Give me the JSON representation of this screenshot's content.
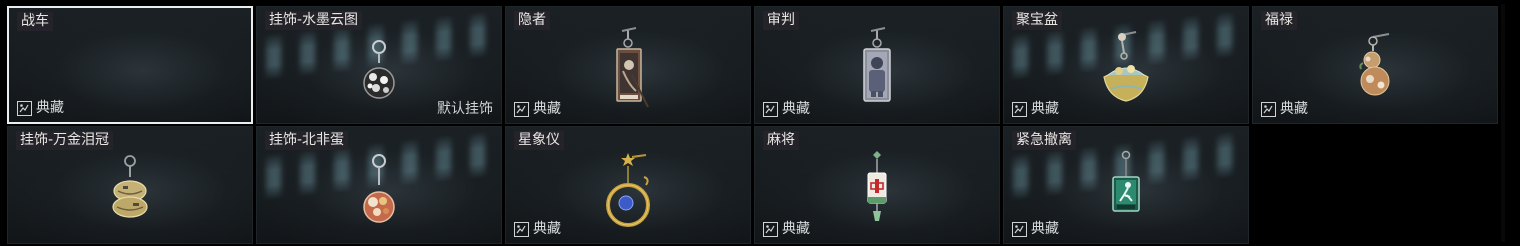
{
  "collection": {
    "items": [
      {
        "title": "战车",
        "badge": "典藏",
        "default_label": ""
      },
      {
        "title": "挂饰-水墨云图",
        "badge": "",
        "default_label": "默认挂饰"
      },
      {
        "title": "隐者",
        "badge": "典藏",
        "default_label": ""
      },
      {
        "title": "审判",
        "badge": "典藏",
        "default_label": ""
      },
      {
        "title": "聚宝盆",
        "badge": "典藏",
        "default_label": ""
      },
      {
        "title": "福禄",
        "badge": "典藏",
        "default_label": ""
      },
      {
        "title": "挂饰-万金泪冠",
        "badge": "",
        "default_label": ""
      },
      {
        "title": "挂饰-北非蛋",
        "badge": "",
        "default_label": ""
      },
      {
        "title": "星象仪",
        "badge": "典藏",
        "default_label": ""
      },
      {
        "title": "麻将",
        "badge": "典藏",
        "default_label": ""
      },
      {
        "title": "紧急撤离",
        "badge": "典藏",
        "default_label": ""
      }
    ]
  },
  "colors": {
    "card_bg": "#161b1e",
    "selected_border": "#e9eef0",
    "title_bg": "#28242c",
    "text": "#e8e6e2"
  },
  "icons": {
    "badge": "collection-card-icon"
  }
}
